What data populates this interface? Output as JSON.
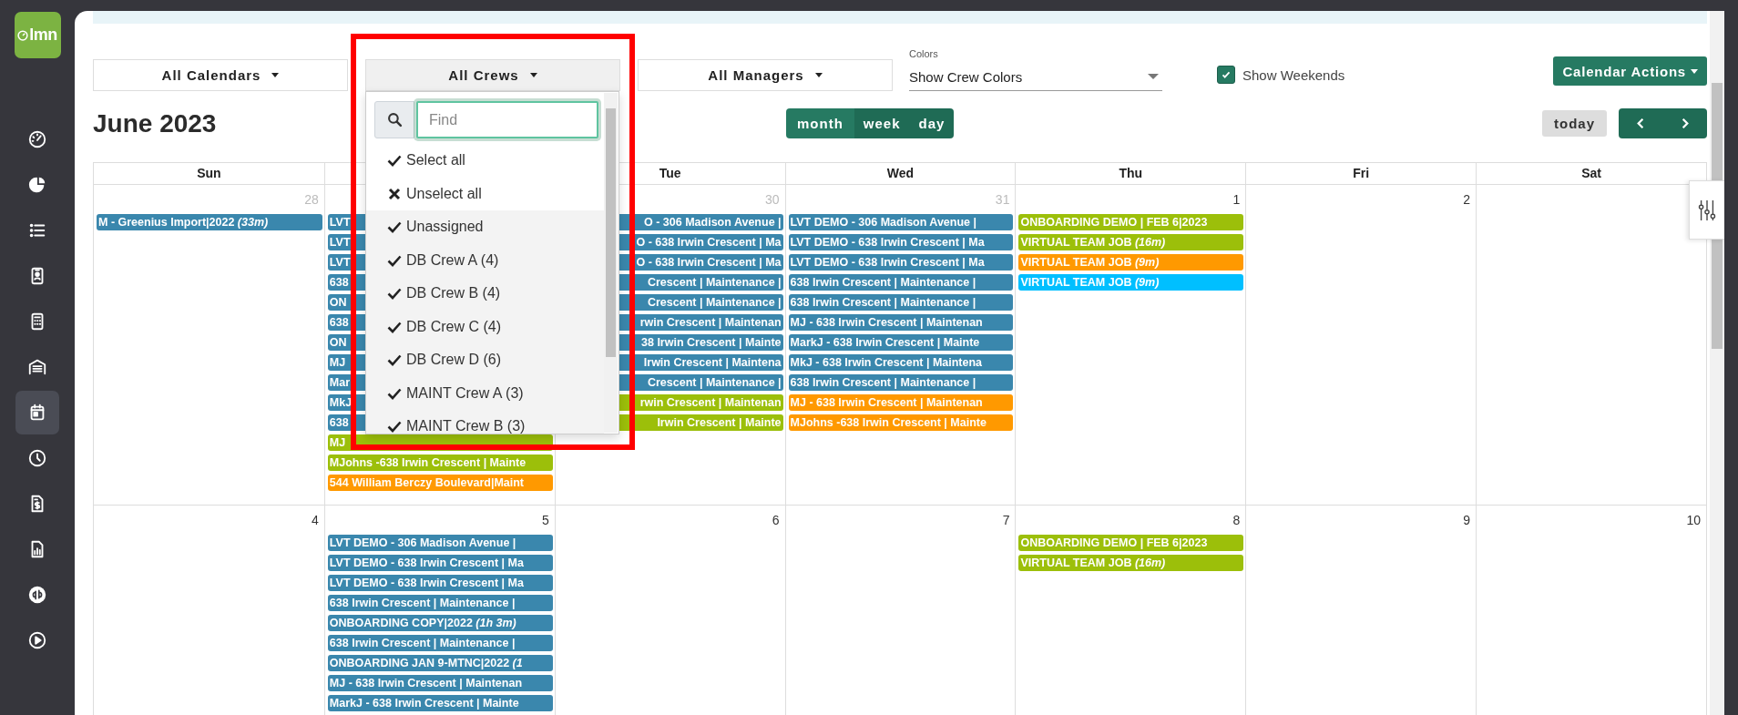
{
  "sidebar": {
    "logo": "lmn",
    "items": [
      {
        "selected": false
      },
      {
        "selected": false
      },
      {
        "selected": false
      },
      {
        "selected": false
      },
      {
        "selected": false
      },
      {
        "selected": false
      },
      {
        "selected": true
      },
      {
        "selected": false
      },
      {
        "selected": false
      },
      {
        "selected": false
      },
      {
        "selected": false
      },
      {
        "selected": false
      }
    ]
  },
  "toolbar": {
    "filters": [
      {
        "label": "All Calendars",
        "open": false
      },
      {
        "label": "All Crews",
        "open": true
      },
      {
        "label": "All Managers",
        "open": false
      }
    ],
    "colors": {
      "label": "Colors",
      "value": "Show Crew Colors"
    },
    "weekends": {
      "label": "Show Weekends",
      "checked": true
    },
    "actions": "Calendar Actions"
  },
  "crew_dropdown": {
    "placeholder": "Find",
    "items": [
      {
        "kind": "select_all",
        "label": "Select all"
      },
      {
        "kind": "unselect_all",
        "label": "Unselect all"
      },
      {
        "kind": "option",
        "label": "Unassigned",
        "checked": true
      },
      {
        "kind": "option",
        "label": "DB Crew A (4)",
        "checked": true
      },
      {
        "kind": "option",
        "label": "DB Crew B (4)",
        "checked": true
      },
      {
        "kind": "option",
        "label": "DB Crew C (4)",
        "checked": true
      },
      {
        "kind": "option",
        "label": "DB Crew D (6)",
        "checked": true
      },
      {
        "kind": "option",
        "label": "MAINT Crew A (3)",
        "checked": true
      },
      {
        "kind": "option",
        "label": "MAINT Crew B (3)",
        "checked": true
      }
    ]
  },
  "title": "June 2023",
  "views": [
    {
      "label": "month",
      "selected": true
    },
    {
      "label": "week",
      "selected": false
    },
    {
      "label": "day",
      "selected": false
    }
  ],
  "today": {
    "label": "today",
    "disabled": true
  },
  "calendar": {
    "headers": [
      {
        "kind": "label",
        "text": "Sun"
      },
      {
        "kind": "covered"
      },
      {
        "kind": "label",
        "text": "Tue"
      },
      {
        "kind": "label",
        "text": "Wed"
      },
      {
        "kind": "label",
        "text": "Thu"
      },
      {
        "kind": "label",
        "text": "Fri"
      },
      {
        "kind": "label",
        "text": "Sat"
      }
    ],
    "weeks": [
      {
        "days": [
          {
            "number": "28",
            "other_month": true,
            "events": [
              {
                "kind": "bar",
                "color": "#3a87ad",
                "title": "M - Greenius Import|2022 *(33m)*"
              }
            ]
          },
          {
            "events": [
              {
                "kind": "bar",
                "color": "#3a87ad",
                "title": "LVT"
              },
              {
                "kind": "bar",
                "color": "#3a87ad",
                "title": "LVT"
              },
              {
                "kind": "bar",
                "color": "#3a87ad",
                "title": "LVT"
              },
              {
                "kind": "bar",
                "color": "#3a87ad",
                "title": "638"
              },
              {
                "kind": "bar",
                "color": "#3a87ad",
                "title": "ON"
              },
              {
                "kind": "bar",
                "color": "#3a87ad",
                "title": "638"
              },
              {
                "kind": "bar",
                "color": "#3a87ad",
                "title": "ON"
              },
              {
                "kind": "bar",
                "color": "#3a87ad",
                "title": "MJ"
              },
              {
                "kind": "bar",
                "color": "#3a87ad",
                "title": "Mar"
              },
              {
                "kind": "bar",
                "color": "#3a87ad",
                "title": "MkJ"
              },
              {
                "kind": "bar",
                "color": "#3a87ad",
                "title": "638"
              },
              {
                "kind": "bar",
                "color": "#9cbf0a",
                "title": "MJ"
              },
              {
                "kind": "bar",
                "color": "#9cbf0a",
                "title": "MJohns -638 Irwin Crescent | Mainte"
              },
              {
                "kind": "bar",
                "color": "#ff9900",
                "title": "544 William Berczy Boulevard|Maint"
              }
            ]
          },
          {
            "number": "30",
            "other_month": true,
            "events": [
              {
                "kind": "tail",
                "color": "#3a87ad",
                "title": "O - 306 Madison Avenue |"
              },
              {
                "kind": "tail",
                "color": "#3a87ad",
                "title": "O - 638 Irwin Crescent | Ma"
              },
              {
                "kind": "tail",
                "color": "#3a87ad",
                "title": "O - 638 Irwin Crescent | Ma"
              },
              {
                "kind": "tail",
                "color": "#3a87ad",
                "title": "Crescent | Maintenance |"
              },
              {
                "kind": "tail",
                "color": "#3a87ad",
                "title": "Crescent | Maintenance |"
              },
              {
                "kind": "tail",
                "color": "#3a87ad",
                "title": "rwin Crescent | Maintenan"
              },
              {
                "kind": "tail",
                "color": "#3a87ad",
                "title": "38 Irwin Crescent | Mainte"
              },
              {
                "kind": "tail",
                "color": "#3a87ad",
                "title": "Irwin Crescent | Maintena"
              },
              {
                "kind": "tail",
                "color": "#3a87ad",
                "title": "Crescent | Maintenance |"
              },
              {
                "kind": "tail",
                "color": "#9cbf0a",
                "title": "rwin Crescent | Maintenan"
              },
              {
                "kind": "tail",
                "color": "#9cbf0a",
                "title": "Irwin Crescent | Mainte"
              }
            ]
          },
          {
            "number": "31",
            "other_month": true,
            "events": [
              {
                "kind": "bar",
                "color": "#3a87ad",
                "title": "LVT DEMO - 306 Madison Avenue |"
              },
              {
                "kind": "bar",
                "color": "#3a87ad",
                "title": "LVT DEMO - 638 Irwin Crescent | Ma"
              },
              {
                "kind": "bar",
                "color": "#3a87ad",
                "title": "LVT DEMO - 638 Irwin Crescent | Ma"
              },
              {
                "kind": "bar",
                "color": "#3a87ad",
                "title": "638 Irwin Crescent | Maintenance |"
              },
              {
                "kind": "bar",
                "color": "#3a87ad",
                "title": "638 Irwin Crescent | Maintenance |"
              },
              {
                "kind": "bar",
                "color": "#3a87ad",
                "title": "MJ - 638 Irwin Crescent | Maintenan"
              },
              {
                "kind": "bar",
                "color": "#3a87ad",
                "title": "MarkJ - 638 Irwin Crescent | Mainte"
              },
              {
                "kind": "bar",
                "color": "#3a87ad",
                "title": "MkJ - 638 Irwin Crescent | Maintena"
              },
              {
                "kind": "bar",
                "color": "#3a87ad",
                "title": "638 Irwin Crescent | Maintenance |"
              },
              {
                "kind": "bar",
                "color": "#ff9900",
                "title": "MJ - 638 Irwin Crescent | Maintenan"
              },
              {
                "kind": "bar",
                "color": "#ff9900",
                "title": "MJohns -638 Irwin Crescent | Mainte"
              }
            ]
          },
          {
            "number": "1",
            "other_month": false,
            "events": [
              {
                "kind": "bar",
                "color": "#9cbf0a",
                "title": "ONBOARDING DEMO | FEB 6|2023"
              },
              {
                "kind": "bar",
                "color": "#9cbf0a",
                "title": "VIRTUAL TEAM JOB *(16m)*"
              },
              {
                "kind": "bar",
                "color": "#ff9900",
                "title": "VIRTUAL TEAM JOB *(9m)*"
              },
              {
                "kind": "bar",
                "color": "#00bfff",
                "title": "VIRTUAL TEAM JOB *(9m)*"
              }
            ]
          },
          {
            "number": "2",
            "other_month": false
          }
        ]
      },
      {
        "days": [
          {
            "number": "4",
            "other_month": false
          },
          {
            "number": "5",
            "other_month": false,
            "events": [
              {
                "kind": "bar",
                "color": "#3a87ad",
                "title": "LVT DEMO - 306 Madison Avenue |"
              },
              {
                "kind": "bar",
                "color": "#3a87ad",
                "title": "LVT DEMO - 638 Irwin Crescent | Ma"
              },
              {
                "kind": "bar",
                "color": "#3a87ad",
                "title": "LVT DEMO - 638 Irwin Crescent | Ma"
              },
              {
                "kind": "bar",
                "color": "#3a87ad",
                "title": "638 Irwin Crescent | Maintenance |"
              },
              {
                "kind": "bar",
                "color": "#3a87ad",
                "title": "ONBOARDING COPY|2022 *(1h 3m)*"
              },
              {
                "kind": "bar",
                "color": "#3a87ad",
                "title": "638 Irwin Crescent | Maintenance |"
              },
              {
                "kind": "bar",
                "color": "#3a87ad",
                "title": "ONBOARDING JAN 9-MTNC|2022 *(1*"
              },
              {
                "kind": "bar",
                "color": "#3a87ad",
                "title": "MJ - 638 Irwin Crescent | Maintenan"
              },
              {
                "kind": "bar",
                "color": "#3a87ad",
                "title": "MarkJ - 638 Irwin Crescent | Mainte"
              }
            ]
          },
          {
            "number": "6",
            "other_month": false
          },
          {
            "number": "7",
            "other_month": false
          },
          {
            "number": "8",
            "other_month": false,
            "events": [
              {
                "kind": "bar",
                "color": "#9cbf0a",
                "title": "ONBOARDING DEMO | FEB 6|2023"
              },
              {
                "kind": "bar",
                "color": "#9cbf0a",
                "title": "VIRTUAL TEAM JOB *(16m)*"
              }
            ]
          },
          {
            "number": "9",
            "other_month": false
          },
          {
            "number": "10",
            "other_month": false
          }
        ]
      }
    ]
  },
  "highlight": {
    "kind": "frame"
  }
}
